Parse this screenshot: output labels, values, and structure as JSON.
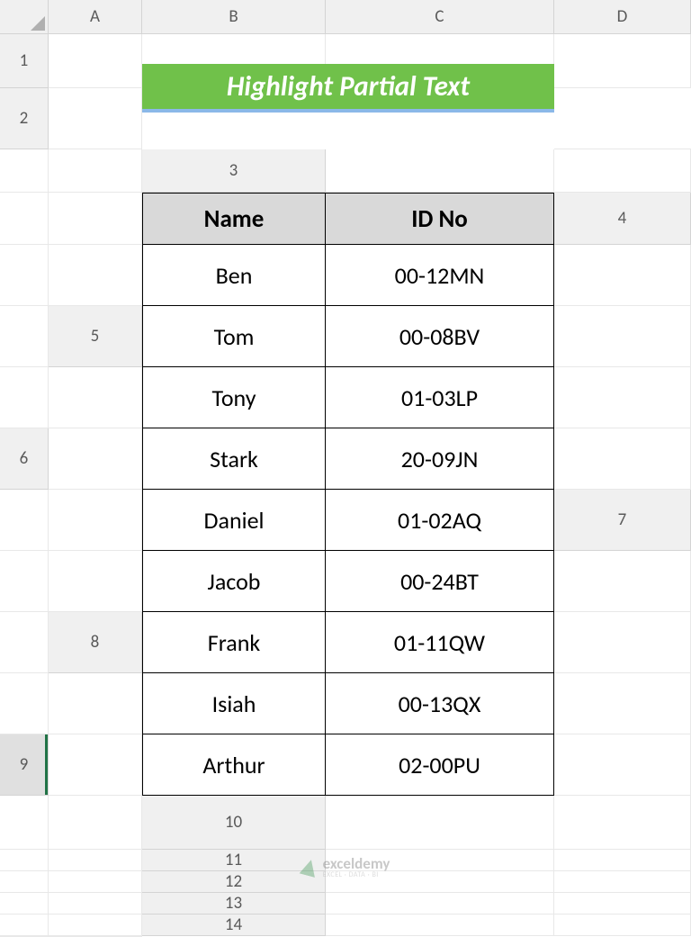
{
  "columns": [
    "A",
    "B",
    "C",
    "D"
  ],
  "rows": [
    "1",
    "2",
    "3",
    "4",
    "5",
    "6",
    "7",
    "8",
    "9",
    "10",
    "11",
    "12",
    "13",
    "14"
  ],
  "active_row": "9",
  "title": "Highlight Partial Text",
  "table": {
    "headers": {
      "name": "Name",
      "id": "ID No"
    },
    "data": [
      {
        "name": "Ben",
        "id": "00-12MN"
      },
      {
        "name": "Tom",
        "id": "00-08BV"
      },
      {
        "name": "Tony",
        "id": "01-03LP"
      },
      {
        "name": "Stark",
        "id": "20-09JN"
      },
      {
        "name": "Daniel",
        "id": "01-02AQ"
      },
      {
        "name": "Jacob",
        "id": "00-24BT"
      },
      {
        "name": "Frank",
        "id": "01-11QW"
      },
      {
        "name": "Isiah",
        "id": "00-13QX"
      },
      {
        "name": "Arthur",
        "id": "02-00PU"
      }
    ]
  },
  "watermark": {
    "main": "exceldemy",
    "sub": "EXCEL · DATA · BI"
  }
}
